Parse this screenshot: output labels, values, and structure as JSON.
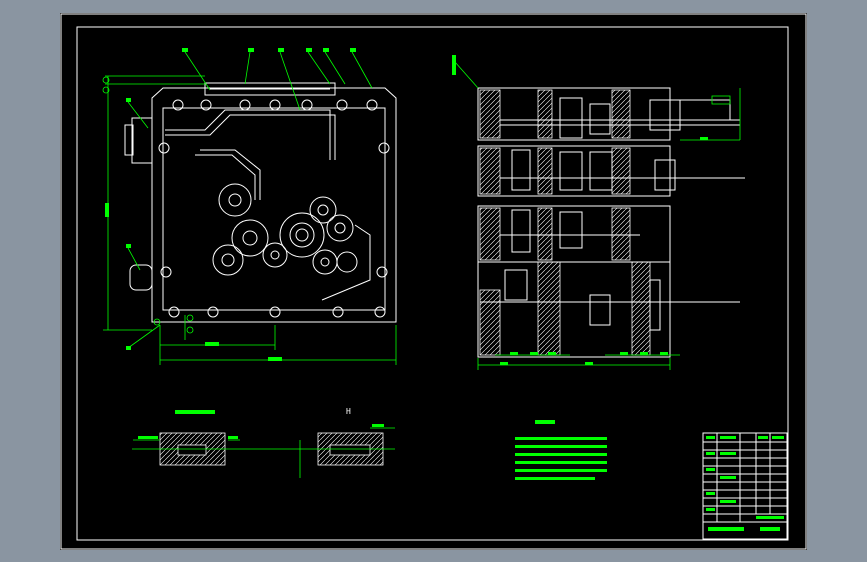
{
  "drawing": {
    "colors": {
      "background": "#000000",
      "outline": "#ffffff",
      "dimension": "#00ff00",
      "canvas": "#8a95a1"
    },
    "section_mark": "H"
  }
}
